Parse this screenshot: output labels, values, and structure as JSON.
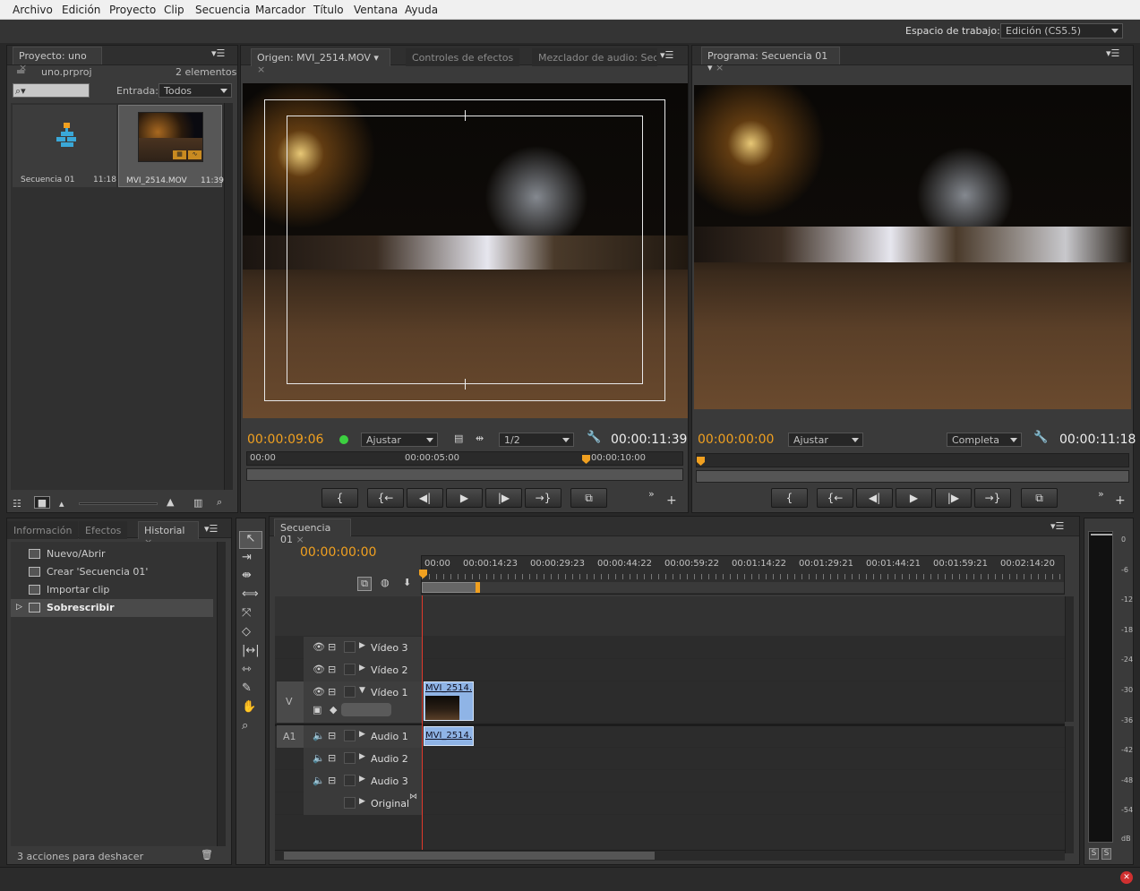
{
  "menu": [
    "Archivo",
    "Edición",
    "Proyecto",
    "Clip",
    "Secuencia",
    "Marcador",
    "Título",
    "Ventana",
    "Ayuda"
  ],
  "workspace": {
    "label": "Espacio de trabajo:",
    "value": "Edición (CS5.5)"
  },
  "project": {
    "tab": "Proyecto: uno",
    "file": "uno.prproj",
    "count": "2 elementos",
    "entrada_label": "Entrada:",
    "entrada_value": "Todos",
    "items": [
      {
        "name": "Secuencia 01",
        "duration": "11:18"
      },
      {
        "name": "MVI_2514.MOV",
        "duration": "11:39"
      }
    ]
  },
  "source": {
    "tabs": [
      "Origen: MVI_2514.MOV",
      "Controles de efectos",
      "Mezclador de audio: Secu"
    ],
    "timecode": "00:00:09:06",
    "fit": "Ajustar",
    "resolution": "1/2",
    "duration": "00:00:11:39",
    "ruler": [
      "00:00",
      "00:00:05:00",
      "00:00:10:00"
    ]
  },
  "program": {
    "tab": "Programa: Secuencia 01",
    "timecode": "00:00:00:00",
    "fit": "Ajustar",
    "resolution": "Completa",
    "duration": "00:00:11:18"
  },
  "history": {
    "tabs": [
      "Información",
      "Efectos",
      "Historial"
    ],
    "items": [
      "Nuevo/Abrir",
      "Crear 'Secuencia 01'",
      "Importar clip",
      "Sobrescribir"
    ],
    "footer": "3 acciones para deshacer"
  },
  "timeline": {
    "tab": "Secuencia 01",
    "timecode": "00:00:00:00",
    "ruler": [
      "00:00",
      "00:00:14:23",
      "00:00:29:23",
      "00:00:44:22",
      "00:00:59:22",
      "00:01:14:22",
      "00:01:29:21",
      "00:01:44:21",
      "00:01:59:21",
      "00:02:14:20"
    ],
    "video_tracks": [
      "Vídeo 3",
      "Vídeo 2",
      "Vídeo 1"
    ],
    "audio_tracks": [
      "Audio 1",
      "Audio 2",
      "Audio 3"
    ],
    "master": "Original",
    "video_target": "V",
    "audio_target": "A1",
    "clip_name": "MVI_2514.",
    "audio_clip_name": "MVI_2514."
  },
  "meter": {
    "labels": [
      "0",
      "-6",
      "-12",
      "-18",
      "-24",
      "-30",
      "-36",
      "-42",
      "-48",
      "-54",
      "dB"
    ],
    "solo": [
      "S",
      "S"
    ]
  },
  "colors": {
    "accent": "#f0a020",
    "clip_blue": "#8fb4e6",
    "playhead": "#e0392b"
  }
}
